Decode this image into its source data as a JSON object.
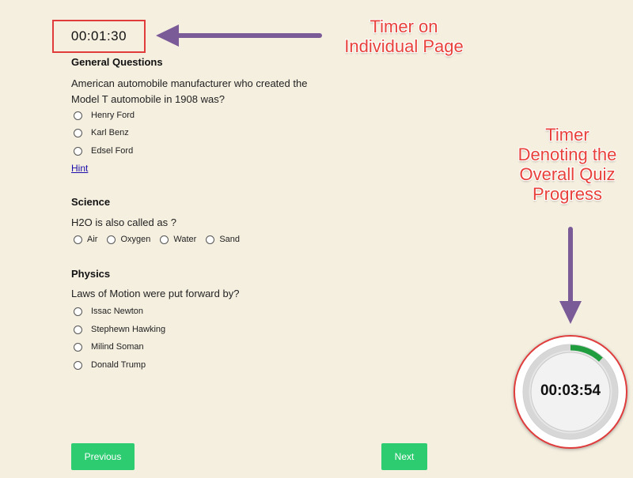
{
  "page_timer": "00:01:30",
  "sections": [
    {
      "title": "General Questions",
      "question": "American automobile manufacturer who created the Model T automobile in 1908 was?",
      "options": [
        "Henry Ford",
        "Karl Benz",
        "Edsel Ford"
      ],
      "hint": "Hint"
    },
    {
      "title": "Science",
      "question": "H2O is also called as ?",
      "options": [
        "Air",
        "Oxygen",
        "Water",
        "Sand"
      ]
    },
    {
      "title": "Physics",
      "question": "Laws of Motion were put forward by?",
      "options": [
        "Issac Newton",
        "Stephewn Hawking",
        "Milind Soman",
        "Donald Trump"
      ]
    }
  ],
  "buttons": {
    "previous": "Previous",
    "next": "Next"
  },
  "overall_timer": {
    "time": "00:03:54",
    "progress_fraction": 0.12
  },
  "annotations": {
    "page_timer": [
      "Timer on",
      "Individual Page"
    ],
    "overall_timer": [
      "Timer",
      "Denoting the",
      "Overall Quiz",
      "Progress"
    ]
  },
  "colors": {
    "background": "#f5efe0",
    "button": "#2ecc71",
    "annotation_text": "#e8403a",
    "arrow": "#7b5a98",
    "highlight_border": "#e03c3c",
    "progress_arc": "#1f9d3f"
  }
}
